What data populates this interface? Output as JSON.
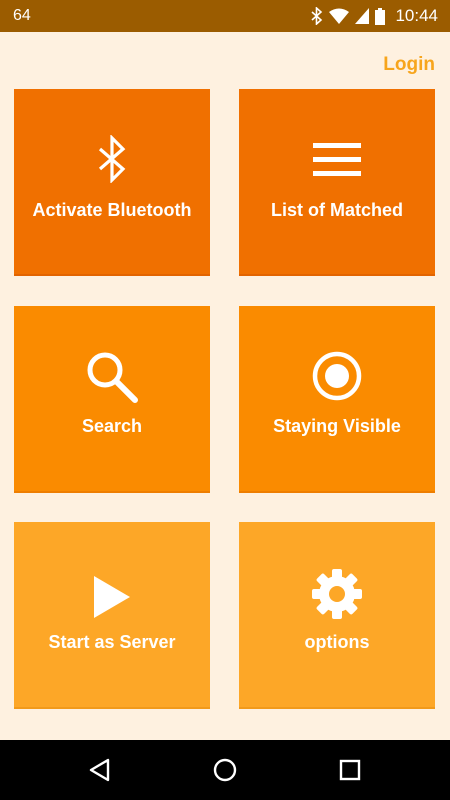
{
  "status_bar": {
    "notification_count": "64",
    "time": "10:44"
  },
  "header": {
    "login_label": "Login"
  },
  "tiles": [
    {
      "label": "Activate Bluetooth",
      "icon": "bluetooth-icon"
    },
    {
      "label": "List of Matched",
      "icon": "list-icon"
    },
    {
      "label": "Search",
      "icon": "search-icon"
    },
    {
      "label": "Staying Visible",
      "icon": "radio-button-icon"
    },
    {
      "label": "Start as Server",
      "icon": "play-icon"
    },
    {
      "label": "options",
      "icon": "gear-icon"
    }
  ],
  "colors": {
    "status_bar": "#9B5C00",
    "background": "#FEF1E0",
    "accent": "#F7A51C",
    "tile_row1": "#F07000",
    "tile_row2": "#FA8B00",
    "tile_row3": "#FDA727"
  }
}
